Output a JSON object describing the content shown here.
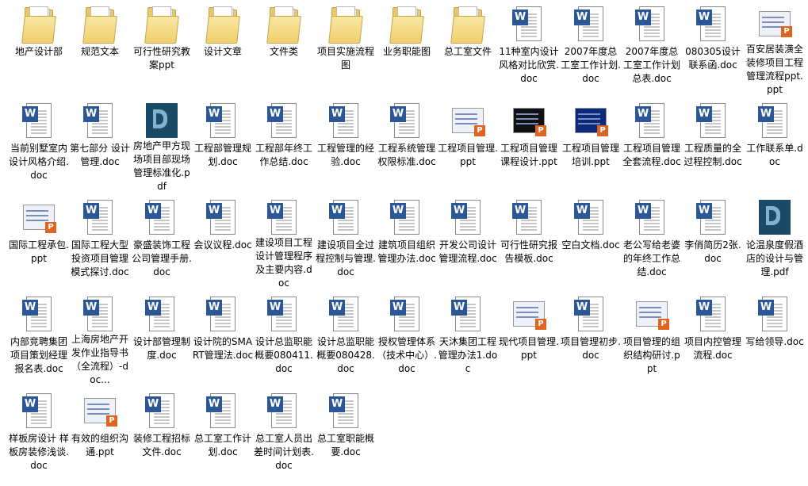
{
  "files": [
    {
      "name": "地产设计部",
      "type": "folder"
    },
    {
      "name": "规范文本",
      "type": "folder"
    },
    {
      "name": "可行性研究教案ppt",
      "type": "folder"
    },
    {
      "name": "设计文章",
      "type": "folder"
    },
    {
      "name": "文件类",
      "type": "folder"
    },
    {
      "name": "项目实施流程图",
      "type": "folder"
    },
    {
      "name": "业务职能图",
      "type": "folder"
    },
    {
      "name": "总工室文件",
      "type": "folder"
    },
    {
      "name": "11种室内设计风格对比欣赏.doc",
      "type": "doc"
    },
    {
      "name": "2007年度总工室工作计划.doc",
      "type": "doc"
    },
    {
      "name": "2007年度总工室工作计划总表.doc",
      "type": "doc"
    },
    {
      "name": "080305设计联系函.doc",
      "type": "doc"
    },
    {
      "name": "百安居装潢全装修项目工程管理流程ppt.ppt",
      "type": "ppt"
    },
    {
      "name": "当前别墅室内设计风格介绍.doc",
      "type": "doc"
    },
    {
      "name": "第七部分 设计管理.doc",
      "type": "doc"
    },
    {
      "name": "房地产甲方现场项目部现场管理标准化.pdf",
      "type": "pdf"
    },
    {
      "name": "工程部管理规划.doc",
      "type": "doc"
    },
    {
      "name": "工程部年终工作总结.doc",
      "type": "doc"
    },
    {
      "name": "工程管理的经验.doc",
      "type": "doc"
    },
    {
      "name": "工程系统管理权限标准.doc",
      "type": "doc"
    },
    {
      "name": "工程项目管理.ppt",
      "type": "ppt"
    },
    {
      "name": "工程项目管理课程设计.ppt",
      "type": "ppt",
      "thumb": "dark"
    },
    {
      "name": "工程项目管理培训.ppt",
      "type": "ppt",
      "thumb": "blue"
    },
    {
      "name": "工程项目管理全套流程.doc",
      "type": "doc"
    },
    {
      "name": "工程质量的全过程控制.doc",
      "type": "doc"
    },
    {
      "name": "工作联系单.doc",
      "type": "doc"
    },
    {
      "name": "国际工程承包.ppt",
      "type": "ppt"
    },
    {
      "name": "国际工程大型投资项目管理模式探讨.doc",
      "type": "doc"
    },
    {
      "name": "豪盛装饰工程公司管理手册.doc",
      "type": "doc"
    },
    {
      "name": "会议议程.doc",
      "type": "doc"
    },
    {
      "name": "建设项目工程设计管理程序及主要内容.doc",
      "type": "doc"
    },
    {
      "name": "建设项目全过程控制与管理.doc",
      "type": "doc"
    },
    {
      "name": "建筑项目组织管理办法.doc",
      "type": "doc"
    },
    {
      "name": "开发公司设计管理流程.doc",
      "type": "doc"
    },
    {
      "name": "可行性研究报告模板.doc",
      "type": "doc"
    },
    {
      "name": "空白文档.doc",
      "type": "doc"
    },
    {
      "name": "老公写给老婆的年终工作总结.doc",
      "type": "doc"
    },
    {
      "name": "李俏简历2张.doc",
      "type": "doc"
    },
    {
      "name": "论温泉度假酒店的设计与管理.pdf",
      "type": "pdf"
    },
    {
      "name": "内部竞聘集团项目策划经理报名表.doc",
      "type": "doc"
    },
    {
      "name": "上海房地产开发作业指导书（全流程）-doc...",
      "type": "doc"
    },
    {
      "name": "设计部管理制度.doc",
      "type": "doc"
    },
    {
      "name": "设计院的SMART管理法.doc",
      "type": "doc"
    },
    {
      "name": "设计总监职能概要080411.doc",
      "type": "doc"
    },
    {
      "name": "设计总监职能概要080428.doc",
      "type": "doc"
    },
    {
      "name": "授权管理体系（技术中心）.doc",
      "type": "doc"
    },
    {
      "name": "天沐集团工程管理办法1.doc",
      "type": "doc"
    },
    {
      "name": "现代项目管理.ppt",
      "type": "ppt"
    },
    {
      "name": "项目管理初步.doc",
      "type": "doc"
    },
    {
      "name": "项目管理的组织结构研讨.ppt",
      "type": "ppt"
    },
    {
      "name": "项目内控管理流程.doc",
      "type": "doc"
    },
    {
      "name": "写给领导.doc",
      "type": "doc"
    },
    {
      "name": "样板房设计 样板房装修浅谈.doc",
      "type": "doc"
    },
    {
      "name": "有效的组织沟通.ppt",
      "type": "ppt"
    },
    {
      "name": "装修工程招标文件.doc",
      "type": "doc"
    },
    {
      "name": "总工室工作计划.doc",
      "type": "doc"
    },
    {
      "name": "总工室人员出差时间计划表.doc",
      "type": "doc"
    },
    {
      "name": "总工室职能概要.doc",
      "type": "doc"
    }
  ],
  "icons": {
    "folder": "folder-icon",
    "doc": "word-document-icon",
    "ppt": "powerpoint-icon",
    "pdf": "pdf-icon"
  },
  "colors": {
    "doc_badge": "#2b5797",
    "ppt_badge": "#e0631f",
    "folder": "#e9c86b",
    "pdf": "#1a4a66"
  }
}
